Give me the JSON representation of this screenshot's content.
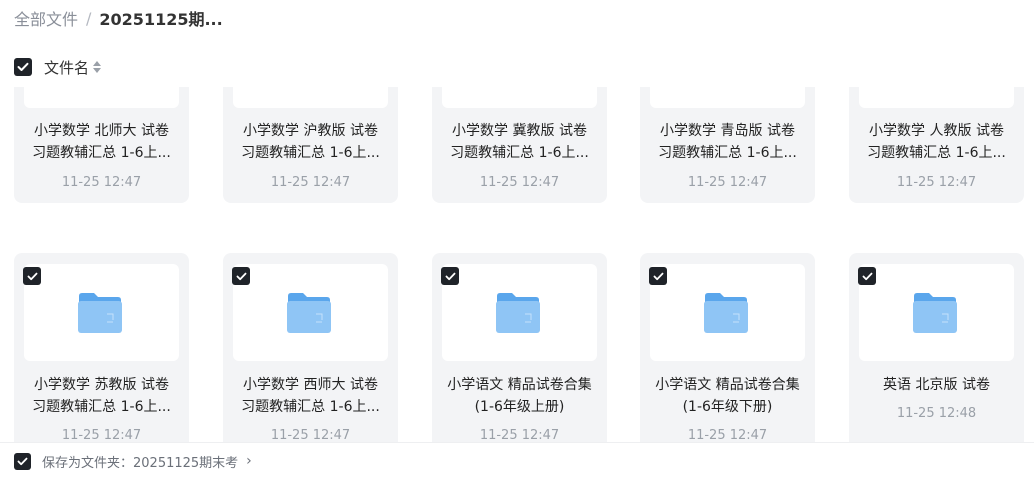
{
  "breadcrumb": {
    "root": "全部文件",
    "separator": "/",
    "current": "20251125期..."
  },
  "list_header": {
    "column": "文件名"
  },
  "top_row": [
    {
      "line1": "小学数学 北师大 试卷",
      "line2": "习题教辅汇总 1-6上...",
      "date": "11-25 12:47"
    },
    {
      "line1": "小学数学 沪教版 试卷",
      "line2": "习题教辅汇总 1-6上...",
      "date": "11-25 12:47"
    },
    {
      "line1": "小学数学 冀教版 试卷",
      "line2": "习题教辅汇总 1-6上...",
      "date": "11-25 12:47"
    },
    {
      "line1": "小学数学 青岛版 试卷",
      "line2": "习题教辅汇总 1-6上...",
      "date": "11-25 12:47"
    },
    {
      "line1": "小学数学 人教版 试卷",
      "line2": "习题教辅汇总 1-6上...",
      "date": "11-25 12:47"
    }
  ],
  "bottom_row": [
    {
      "line1": "小学数学 苏教版 试卷",
      "line2": "习题教辅汇总 1-6上...",
      "date": "11-25 12:47"
    },
    {
      "line1": "小学数学 西师大 试卷",
      "line2": "习题教辅汇总 1-6上...",
      "date": "11-25 12:47"
    },
    {
      "line1": "小学语文 精品试卷合集",
      "line2": "(1-6年级上册)",
      "date": "11-25 12:47"
    },
    {
      "line1": "小学语文 精品试卷合集",
      "line2": "(1-6年级下册)",
      "date": "11-25 12:47"
    },
    {
      "line1": "英语 北京版 试卷",
      "line2": "",
      "date": "11-25 12:48"
    }
  ],
  "footer": {
    "save_text": "保存为文件夹：20251125期末考",
    "chevron": "›"
  },
  "colors": {
    "checkbox": "#1f2329",
    "card_bg": "#f3f4f6",
    "folder_front": "#8fc5f5",
    "folder_back": "#5aa6ec"
  }
}
